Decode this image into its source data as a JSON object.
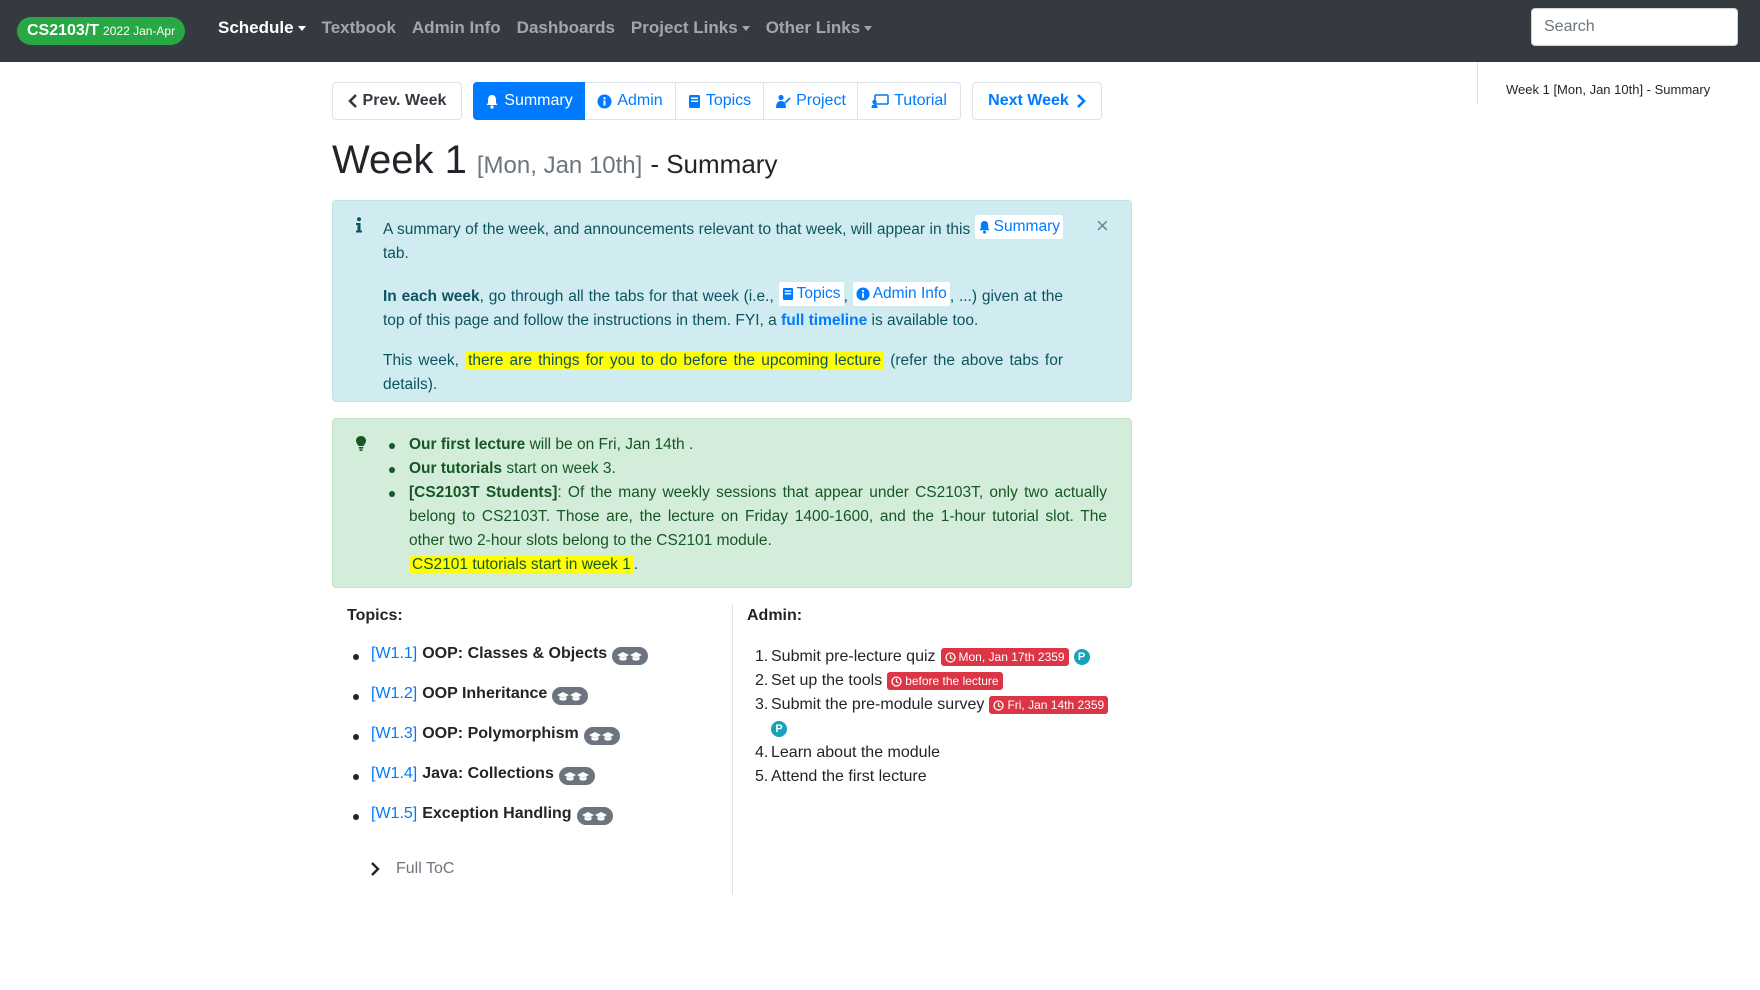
{
  "navbar": {
    "brand": "CS2103/T",
    "brand_sub": "2022 Jan-Apr",
    "links": [
      {
        "label": "Schedule",
        "dropdown": true,
        "active": true
      },
      {
        "label": "Textbook"
      },
      {
        "label": "Admin Info"
      },
      {
        "label": "Dashboards"
      },
      {
        "label": "Project Links",
        "dropdown": true
      },
      {
        "label": "Other Links",
        "dropdown": true
      }
    ],
    "search_placeholder": "Search"
  },
  "toc": {
    "item": "Week 1 [Mon, Jan 10th] - Summary"
  },
  "buttons": {
    "prev": "Prev. Week",
    "summary": "Summary",
    "admin": "Admin",
    "topics": "Topics",
    "project": "Project",
    "tutorial": "Tutorial",
    "next": "Next Week"
  },
  "heading": {
    "main": "Week 1",
    "date": "[Mon, Jan 10th]",
    "sub": "- Summary"
  },
  "info_alert": {
    "p1_text": "A summary of the week, and announcements relevant to that week, will appear in this",
    "p1_link": "Summary",
    "p1_end": "tab.",
    "p2_bold": "In each week",
    "p2_text1": ", go through all the tabs for that week (i.e.,",
    "p2_link1": "Topics",
    "p2_sep": ",",
    "p2_link2": "Admin Info",
    "p2_text2": ", ...) given at the top of this page and follow the instructions in them. FYI, a",
    "p2_link3": "full timeline",
    "p2_text3": "is available too.",
    "p3_text1": "This week,",
    "p3_highlight": "there are things for you to do before the upcoming lecture",
    "p3_text2": "(refer the above tabs for details)."
  },
  "success_alert": {
    "i1_bold": "Our first lecture",
    "i1_text": "will be on Fri, Jan 14th .",
    "i2_bold": "Our tutorials",
    "i2_text": "start on week 3.",
    "i3_bold": "[CS2103T Students]",
    "i3_text": ": Of the many weekly sessions that appear under CS2103T, only two actually belong to CS2103T. Those are, the lecture on Friday 1400-1600, and the 1-hour tutorial slot. The other two 2-hour slots belong to the CS2101 module.",
    "i3_highlight": "CS2101 tutorials start in week 1",
    "i3_end": "."
  },
  "topics": {
    "title": "Topics:",
    "items": [
      {
        "id": "[W1.1]",
        "name": "OOP: Classes & Objects"
      },
      {
        "id": "[W1.2]",
        "name": "OOP Inheritance"
      },
      {
        "id": "[W1.3]",
        "name": "OOP: Polymorphism"
      },
      {
        "id": "[W1.4]",
        "name": "Java: Collections"
      },
      {
        "id": "[W1.5]",
        "name": "Exception Handling"
      }
    ],
    "full_toc": "Full ToC"
  },
  "admin": {
    "title": "Admin:",
    "items": [
      {
        "num": "1.",
        "text": "Submit pre-lecture quiz",
        "badge": "Mon, Jan 17th 2359",
        "p": "P"
      },
      {
        "num": "2.",
        "text": "Set up the tools",
        "badge": "before the lecture"
      },
      {
        "num": "3.",
        "text": "Submit the pre-module survey",
        "badge": "Fri, Jan 14th 2359",
        "p": "P"
      },
      {
        "num": "4.",
        "text": "Learn about the module"
      },
      {
        "num": "5.",
        "text": "Attend the first lecture"
      }
    ]
  },
  "colors": {
    "navbar_bg": "#343a40",
    "brand_green": "#28a745",
    "primary_blue": "#007bff",
    "info_bg": "#d1ecf1",
    "success_bg": "#d4edda",
    "danger_red": "#dc3545",
    "highlight_yellow": "#ffff00"
  },
  "icons": {
    "prev": "chevron-left-icon",
    "summary": "bell-icon",
    "admin": "info-circle-icon",
    "topics": "book-icon",
    "project": "project-icon",
    "tutorial": "chalkboard-icon",
    "next": "chevron-right-icon",
    "info_alert": "info-icon",
    "success_alert": "lightbulb-icon",
    "close": "close-icon",
    "topic_badge": "graduation-cap-icon",
    "deadline": "clock-icon",
    "full_toc": "chevron-right-icon"
  }
}
